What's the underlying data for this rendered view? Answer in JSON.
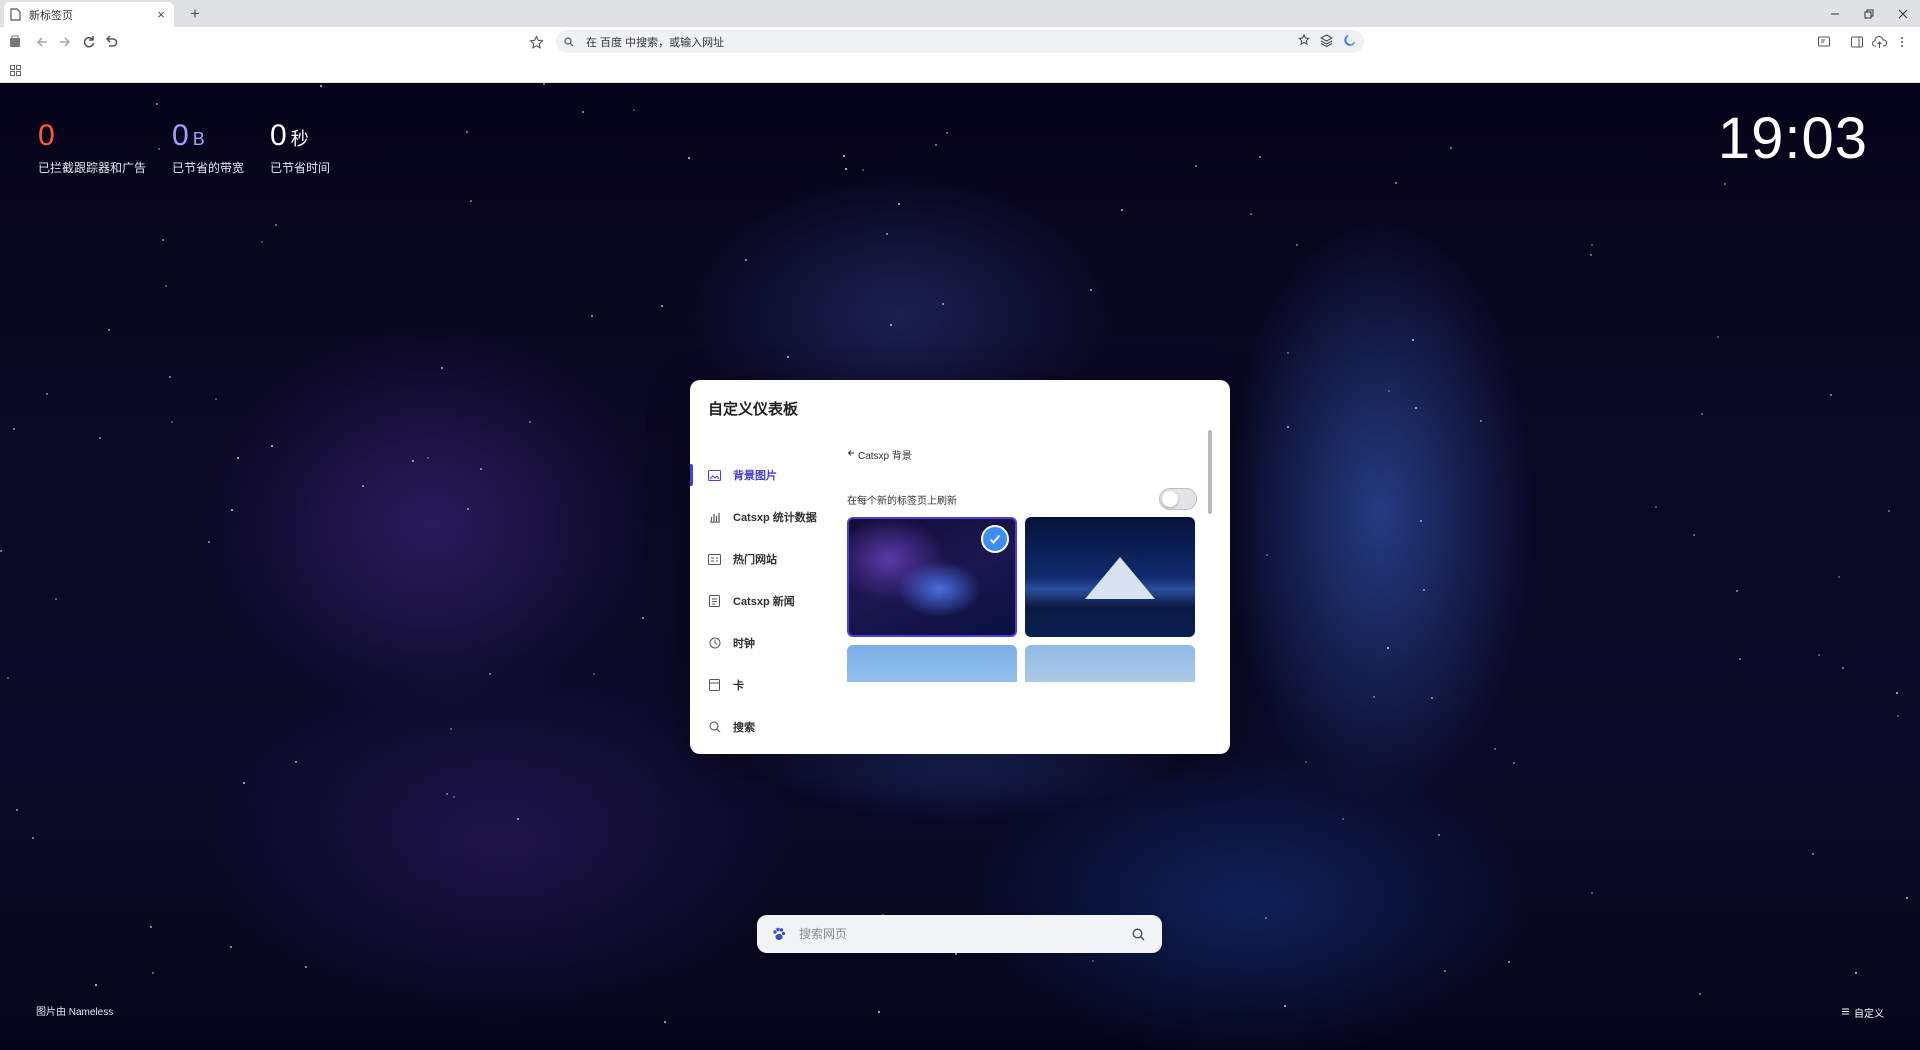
{
  "browser": {
    "tab_title": "新标签页",
    "tab_close": "×",
    "new_tab": "+",
    "omnibox_placeholder": "在 百度 中搜索，或输入网址"
  },
  "stats": [
    {
      "value": "0",
      "unit": "",
      "label": "已拦截跟踪器和广告"
    },
    {
      "value": "0",
      "unit": "B",
      "label": "已节省的带宽"
    },
    {
      "value": "0",
      "unit": "秒",
      "label": "已节省时间"
    }
  ],
  "clock": "19:03",
  "credit": "图片由 Nameless",
  "customize_label": "自定义",
  "search": {
    "placeholder": "搜索网页"
  },
  "dialog": {
    "title": "自定义仪表板",
    "nav": [
      {
        "label": "背景图片",
        "icon": "image-icon",
        "active": true
      },
      {
        "label": "Catsxp 统计数据",
        "icon": "bar-chart-icon",
        "active": false
      },
      {
        "label": "热门网站",
        "icon": "sites-icon",
        "active": false
      },
      {
        "label": "Catsxp 新闻",
        "icon": "news-icon",
        "active": false
      },
      {
        "label": "时钟",
        "icon": "clock-icon",
        "active": false
      },
      {
        "label": "卡",
        "icon": "card-icon",
        "active": false
      },
      {
        "label": "搜索",
        "icon": "search-icon",
        "active": false
      }
    ],
    "back_label": "Catsxp 背景",
    "refresh_label": "在每个新的标签页上刷新",
    "refresh_enabled": false
  },
  "colors": {
    "accent": "#4a3fd6",
    "check": "#3b8ef5",
    "stat_red": "#ff5a36",
    "stat_purple": "#a59cff"
  }
}
